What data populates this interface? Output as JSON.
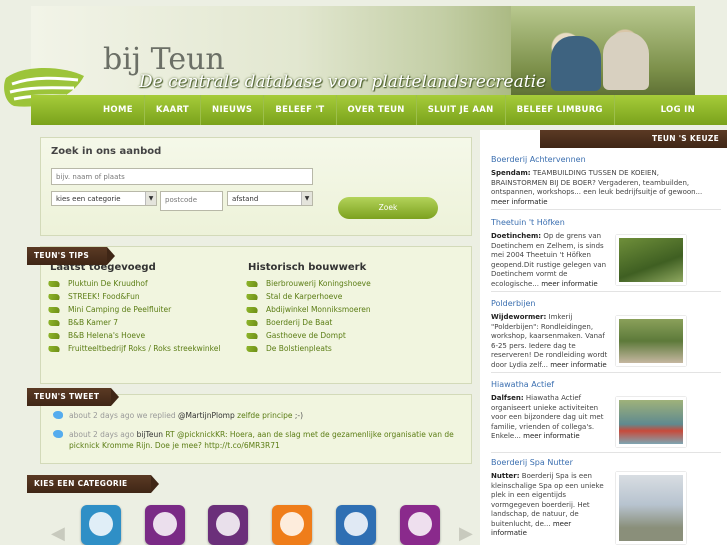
{
  "banner": {
    "logo_text": "bij Teun",
    "tagline": "De centrale database voor plattelandsrecreatie"
  },
  "nav": {
    "items": [
      "HOME",
      "KAART",
      "NIEUWS",
      "BELEEF 'T",
      "OVER TEUN",
      "SLUIT JE AAN",
      "BELEEF LIMBURG"
    ],
    "login": "LOG IN"
  },
  "search": {
    "title": "Zoek in ons aanbod",
    "keyword_placeholder": "bijv. naam of plaats",
    "category_value": "kies een categorie",
    "postcode_placeholder": "postcode",
    "distance_value": "afstand",
    "button": "Zoek"
  },
  "tips": {
    "ribbon": "TEUN'S TIPS",
    "col1_title": "Laatst toegevoegd",
    "col1": [
      "Pluktuin De Kruudhof",
      "STREEK! Food&Fun",
      "Mini Camping de Peelfluiter",
      "B&B Kamer 7",
      "B&B Helena's Hoeve",
      "Fruitteeltbedrijf Roks / Roks streekwinkel"
    ],
    "col2_title": "Historisch bouwwerk",
    "col2": [
      "Bierbrouwerij Koningshoeve",
      "Stal de Karperhoeve",
      "Abdijwinkel Monniksmoeren",
      "Boerderij De Baat",
      "Gasthoeve de Dompt",
      "De Bolstienpleats"
    ]
  },
  "tweets": {
    "ribbon": "TEUN'S TWEET",
    "t1_time": "about 2 days ago",
    "t1_pre": "we replied",
    "t1_user": "@MartijnPlomp",
    "t1_link": "zelfde principe",
    "t1_end": ";-)",
    "t2_time": "about 2 days ago",
    "t2_user": "bijTeun",
    "t2_rt": "RT @picknickKR:",
    "t2_text": "Hoera, aan de slag met de gezamenlijke organisatie van de picknick Kromme Rijn. Doe je mee?",
    "t2_url": "http://t.co/6MR3R71"
  },
  "categories": {
    "ribbon": "KIES EEN CATEGORIE",
    "icons": [
      {
        "name": "family-icon",
        "color": "#2f8fc6"
      },
      {
        "name": "food-drink-icon",
        "color": "#7a2a86"
      },
      {
        "name": "coffee-icon",
        "color": "#6b2f7a"
      },
      {
        "name": "sun-icon",
        "color": "#ef7d1a"
      },
      {
        "name": "elephant-icon",
        "color": "#2f6fb3"
      },
      {
        "name": "info-icon",
        "color": "#8a2a8c"
      }
    ]
  },
  "sidebar": {
    "ribbon": "TEUN 'S KEUZE",
    "entries": [
      {
        "title": "Boerderij Achtervennen",
        "place": "Spendam:",
        "text": "TEAMBUILDING TUSSEN DE KOEIEN, BRAINSTORMEN BIJ DE BOER? Vergaderen, teambuilden, ontspannen, workshops... een leuk bedrijfsuitje of gewoon...",
        "more": "meer informatie"
      },
      {
        "title": "Theetuin 't Höfken",
        "place": "Doetinchem:",
        "text": "Op de grens van Doetinchem en Zelhem, is sinds mei 2004 Theetuin 't Höfken geopend.Dit rustige gelegen van Doetinchem vormt de ecologische...",
        "more": "meer informatie"
      },
      {
        "title": "Polderbijen",
        "place": "Wijdewormer:",
        "text": "Imkerij \"Polderbijen\": Rondleidingen, workshop, kaarsenmaken. Vanaf 6-25 pers. Iedere dag te reserveren! De rondleiding wordt door Lydia zelf...",
        "more": "meer informatie"
      },
      {
        "title": "Hiawatha Actief",
        "place": "Dalfsen:",
        "text": "Hiawatha Actief organiseert unieke activiteiten voor een bijzondere dag uit met familie, vrienden of collega's. Enkele...",
        "more": "meer informatie"
      },
      {
        "title": "Boerderij Spa Nutter",
        "place": "Nutter:",
        "text": "Boerderij Spa is een kleinschalige Spa op een unieke plek in een eigentijds vormgegeven boerderij. Het landschap, de natuur, de buitenlucht, de...",
        "more": "meer informatie"
      }
    ]
  }
}
